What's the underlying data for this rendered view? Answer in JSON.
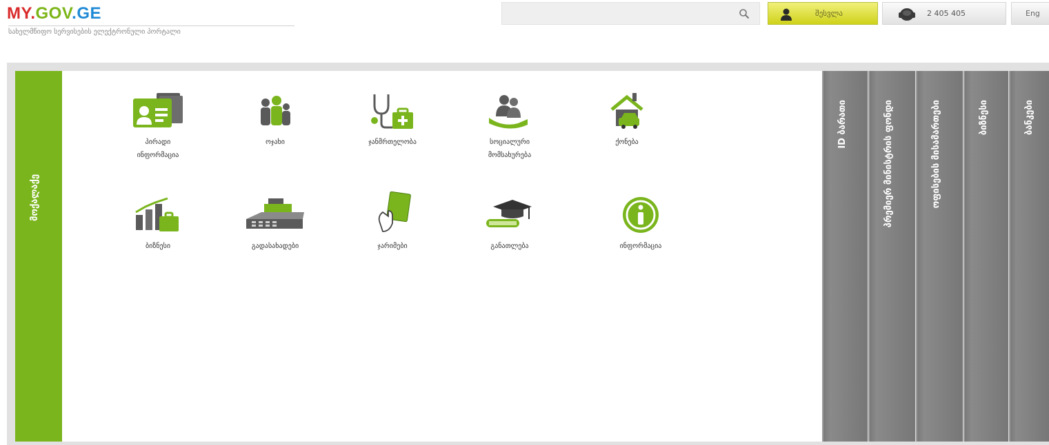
{
  "header": {
    "logo_part1": "MY.",
    "logo_part2": "GOV",
    "logo_part3": ".GE",
    "tagline": "სახელმწიფო სერვისების ელექტრონული პორტალი",
    "search_placeholder": "",
    "login_label": "შესვლა",
    "phone_label": "2 405 405",
    "lang_label": "Eng"
  },
  "left_tab": {
    "label": "მოქალაქე"
  },
  "services": [
    {
      "id": "personal-info",
      "label_line1": "პირადი",
      "label_line2": "ინფორმაცია",
      "icon": "id-card-icon"
    },
    {
      "id": "family",
      "label_line1": "ოჯახი",
      "label_line2": "",
      "icon": "family-icon"
    },
    {
      "id": "health",
      "label_line1": "ჯანმრთელობა",
      "label_line2": "",
      "icon": "stethoscope-icon"
    },
    {
      "id": "social",
      "label_line1": "სოციალური",
      "label_line2": "მომსახურება",
      "icon": "social-care-icon"
    },
    {
      "id": "property",
      "label_line1": "ქონება",
      "label_line2": "",
      "icon": "house-car-icon"
    },
    {
      "id": "business",
      "label_line1": "ბიზნესი",
      "label_line2": "",
      "icon": "business-chart-icon"
    },
    {
      "id": "payments",
      "label_line1": "გადასახადები",
      "label_line2": "",
      "icon": "cash-register-icon"
    },
    {
      "id": "fines",
      "label_line1": "ჯარიმები",
      "label_line2": "",
      "icon": "penalty-card-icon"
    },
    {
      "id": "education",
      "label_line1": "განათლება",
      "label_line2": "",
      "icon": "graduation-cap-icon"
    },
    {
      "id": "information",
      "label_line1": "ინფორმაცია",
      "label_line2": "",
      "icon": "info-icon"
    }
  ],
  "right_tabs": [
    {
      "label": "ID ბარათი"
    },
    {
      "label": "პრემიერ მინისტრის ფონდი"
    },
    {
      "label": "ოფისების მისამართები"
    },
    {
      "label": "ბიზნესი"
    },
    {
      "label": "ბანკები"
    }
  ],
  "colors": {
    "brand_green": "#7ab51d",
    "side_tab_gray": "#7e7e7e",
    "logo_red": "#d92b2b",
    "logo_green": "#7cb518",
    "logo_blue": "#1f8ad6"
  }
}
